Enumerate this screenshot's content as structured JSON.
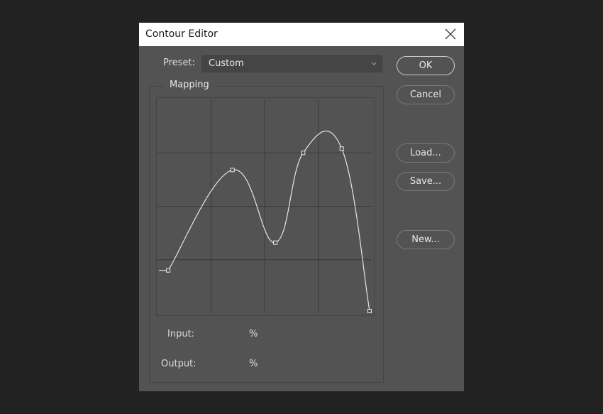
{
  "window": {
    "title": "Contour Editor",
    "close_icon": "close-icon"
  },
  "preset": {
    "label": "Preset:",
    "value": "Custom"
  },
  "buttons": {
    "ok": "OK",
    "cancel": "Cancel",
    "load": "Load...",
    "save": "Save...",
    "new": "New..."
  },
  "mapping": {
    "label": "Mapping",
    "input_label": "Input:",
    "input_unit": "%",
    "output_label": "Output:",
    "output_unit": "%",
    "grid_divisions": 4,
    "curve_points_percent": [
      {
        "input": 5,
        "output": 20
      },
      {
        "input": 35,
        "output": 67
      },
      {
        "input": 55,
        "output": 33
      },
      {
        "input": 68,
        "output": 75
      },
      {
        "input": 86,
        "output": 77
      },
      {
        "input": 99,
        "output": 1
      }
    ]
  },
  "colors": {
    "dialog_bg": "#535353",
    "curve": "#e6e6e6",
    "grid": "#3a3a3a"
  }
}
